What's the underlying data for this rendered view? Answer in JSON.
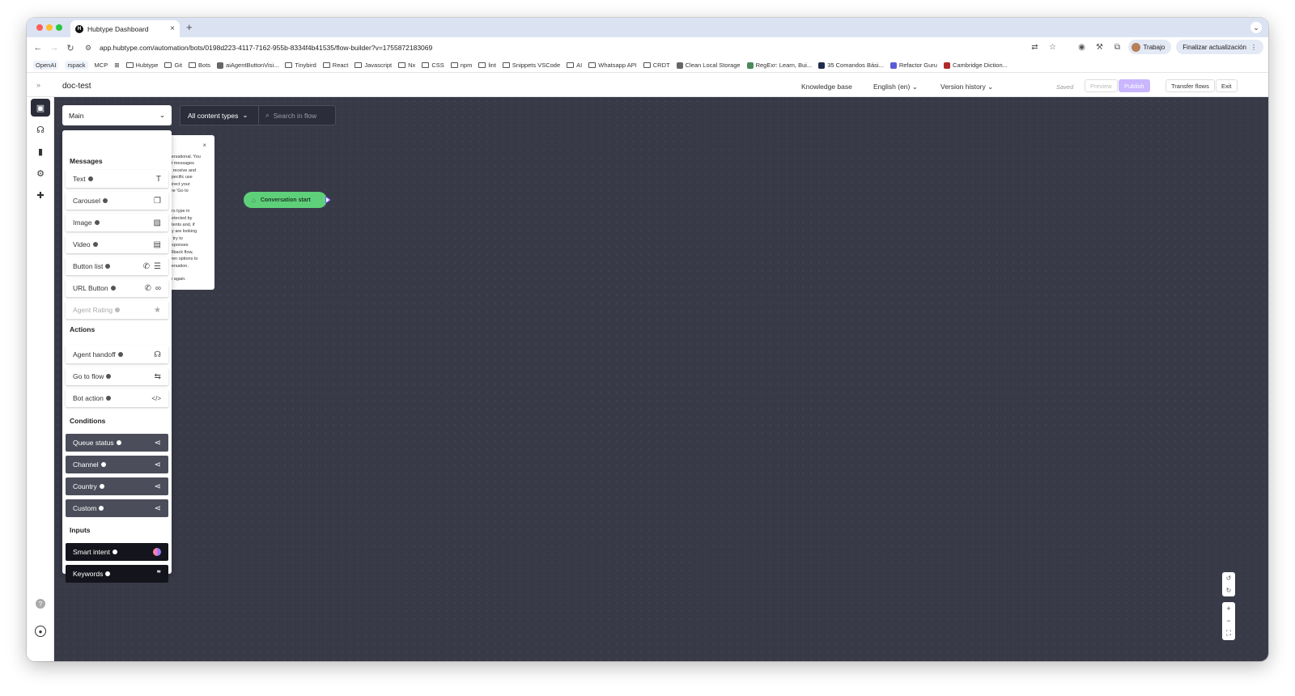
{
  "browser": {
    "tab_title": "Hubtype Dashboard",
    "tab_favicon": "H",
    "new_tab": "+",
    "url": "app.hubtype.com/automation/bots/0198d223-4117-7162-955b-8334f4b41535/flow-builder?v=1755872183069",
    "profile": "Trabajo",
    "update_button": "Finalizar actualización"
  },
  "bookmarks": [
    {
      "label": "OpenAI",
      "kind": "tag"
    },
    {
      "label": "rspack",
      "kind": "tag"
    },
    {
      "label": "MCP",
      "kind": "plain"
    },
    {
      "label": "Hubtype",
      "kind": "folder"
    },
    {
      "label": "Git",
      "kind": "folder"
    },
    {
      "label": "Bots",
      "kind": "folder"
    },
    {
      "label": "aiAgentButtonVisi...",
      "kind": "site"
    },
    {
      "label": "Tinybird",
      "kind": "folder"
    },
    {
      "label": "React",
      "kind": "folder"
    },
    {
      "label": "Javascript",
      "kind": "folder"
    },
    {
      "label": "Nx",
      "kind": "folder"
    },
    {
      "label": "CSS",
      "kind": "folder"
    },
    {
      "label": "npm",
      "kind": "folder"
    },
    {
      "label": "lint",
      "kind": "folder"
    },
    {
      "label": "Snippets VSCode",
      "kind": "folder"
    },
    {
      "label": "AI",
      "kind": "folder"
    },
    {
      "label": "Whatsapp API",
      "kind": "folder"
    },
    {
      "label": "CRDT",
      "kind": "folder"
    },
    {
      "label": "Clean Local Storage",
      "kind": "site"
    },
    {
      "label": "RegExr: Learn, Bui...",
      "kind": "site"
    },
    {
      "label": "35 Comandos Bási...",
      "kind": "site"
    },
    {
      "label": "Refactor Guru",
      "kind": "site"
    },
    {
      "label": "Cambridge Diction...",
      "kind": "site"
    }
  ],
  "header": {
    "bot_name": "doc-test",
    "knowledge_base": "Knowledge base",
    "language": "English (en)",
    "version_history": "Version history",
    "saved": "Saved",
    "preview": "Preview",
    "publish": "Publish",
    "transfer_flows": "Transfer flows",
    "exit": "Exit"
  },
  "toolbar": {
    "flow_select": "Main",
    "content_filter": "All content types",
    "search_placeholder": "Search in flow"
  },
  "tooltip": {
    "close": "×",
    "text": "versational. You\nst messages\no receive and\n specific use\ndirect your\n the 'Go to\n\n\ners type in\n detected by\nntents and, if\ney are looking\nn try to\nesponses\nallback flow,\niven options to\nversation.\n\nle again."
  },
  "canvas": {
    "start_node": "Conversation start"
  },
  "palette": {
    "messages_title": "Messages",
    "messages": [
      {
        "label": "Text",
        "icon": "text-icon"
      },
      {
        "label": "Carousel",
        "icon": "carousel-icon"
      },
      {
        "label": "Image",
        "icon": "image-icon"
      },
      {
        "label": "Video",
        "icon": "video-icon"
      },
      {
        "label": "Button list",
        "icon": "list-icon"
      },
      {
        "label": "URL Button",
        "icon": "link-icon"
      },
      {
        "label": "Agent Rating",
        "icon": "star-icon"
      }
    ],
    "actions_title": "Actions",
    "actions": [
      {
        "label": "Agent handoff",
        "icon": "headset-icon"
      },
      {
        "label": "Go to flow",
        "icon": "flow-icon"
      },
      {
        "label": "Bot action",
        "icon": "code-icon"
      }
    ],
    "conditions_title": "Conditions",
    "conditions": [
      {
        "label": "Queue status",
        "icon": "branch-icon"
      },
      {
        "label": "Channel",
        "icon": "branch-icon"
      },
      {
        "label": "Country",
        "icon": "branch-icon"
      },
      {
        "label": "Custom",
        "icon": "branch-icon"
      }
    ],
    "inputs_title": "Inputs",
    "inputs": [
      {
        "label": "Smart intent",
        "icon": "brain-icon"
      },
      {
        "label": "Keywords",
        "icon": "quote-icon"
      }
    ]
  },
  "colors": {
    "canvas": "#383a48",
    "start_node": "#5fd07a",
    "publish": "#c9b6ff",
    "condition": "#4b4d5a",
    "input": "#14151c"
  }
}
